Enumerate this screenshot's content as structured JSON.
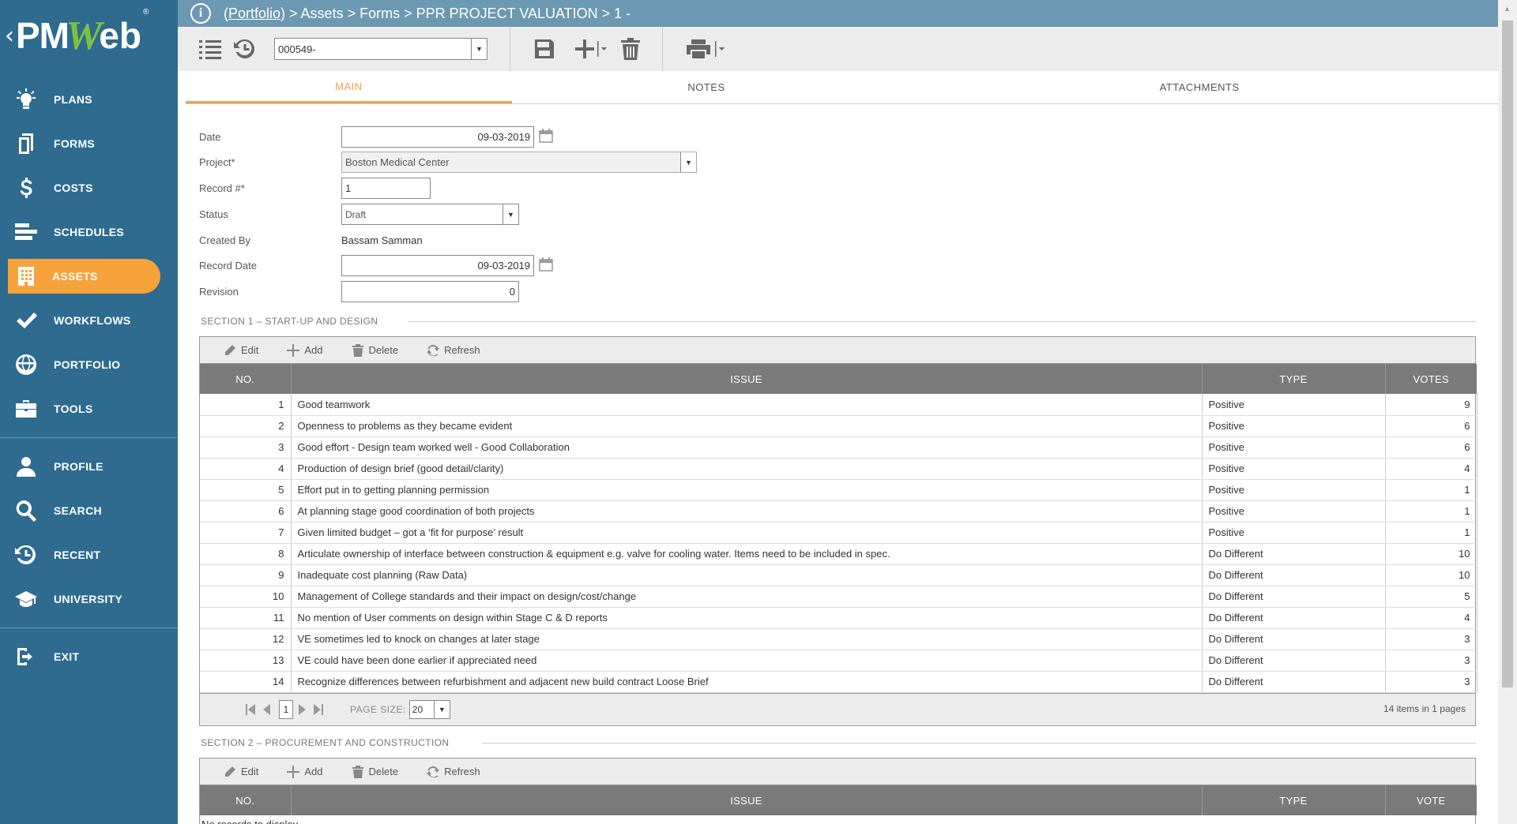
{
  "logo": {
    "back": "‹",
    "pm": "PM",
    "w": "W",
    "eb": "eb",
    "reg": "®"
  },
  "sidebar": {
    "group1": [
      {
        "label": "PLANS",
        "icon": "lightbulb-icon"
      },
      {
        "label": "FORMS",
        "icon": "document-icon"
      },
      {
        "label": "COSTS",
        "icon": "dollar-icon"
      },
      {
        "label": "SCHEDULES",
        "icon": "bars-icon"
      },
      {
        "label": "ASSETS",
        "icon": "building-icon",
        "active": true
      },
      {
        "label": "WORKFLOWS",
        "icon": "check-icon"
      },
      {
        "label": "PORTFOLIO",
        "icon": "globe-icon"
      },
      {
        "label": "TOOLS",
        "icon": "briefcase-icon"
      }
    ],
    "group2": [
      {
        "label": "PROFILE",
        "icon": "user-icon"
      },
      {
        "label": "SEARCH",
        "icon": "search-icon"
      },
      {
        "label": "RECENT",
        "icon": "history-icon"
      },
      {
        "label": "UNIVERSITY",
        "icon": "graduation-cap-icon"
      }
    ],
    "group3": [
      {
        "label": "EXIT",
        "icon": "exit-icon"
      }
    ]
  },
  "breadcrumb": {
    "info": "i",
    "portfolio": "(Portfolio)",
    "rest": " > Assets > Forms > PPR PROJECT VALUATION > 1 -"
  },
  "toolbar": {
    "record_value": "000549-"
  },
  "tabs": [
    "MAIN",
    "NOTES",
    "ATTACHMENTS"
  ],
  "form": {
    "date_label": "Date",
    "date_value": "09-03-2019",
    "project_label": "Project*",
    "project_value": "Boston Medical Center",
    "record_label": "Record #*",
    "record_value": "1",
    "status_label": "Status",
    "status_value": "Draft",
    "created_by_label": "Created By",
    "created_by_value": "Bassam Samman",
    "record_date_label": "Record Date",
    "record_date_value": "09-03-2019",
    "revision_label": "Revision",
    "revision_value": "0"
  },
  "section1": {
    "title": "SECTION 1 – START-UP AND DESIGN",
    "tools": {
      "edit": "Edit",
      "add": "Add",
      "delete": "Delete",
      "refresh": "Refresh"
    },
    "columns": [
      "NO.",
      "ISSUE",
      "TYPE",
      "VOTES"
    ],
    "rows": [
      {
        "no": "1",
        "issue": "Good teamwork",
        "type": "Positive",
        "votes": "9"
      },
      {
        "no": "2",
        "issue": "Openness to problems as they became evident",
        "type": "Positive",
        "votes": "6"
      },
      {
        "no": "3",
        "issue": "Good effort - Design team worked well - Good Collaboration",
        "type": "Positive",
        "votes": "6"
      },
      {
        "no": "4",
        "issue": "Production of design brief (good detail/clarity)",
        "type": "Positive",
        "votes": "4"
      },
      {
        "no": "5",
        "issue": "Effort put in to getting planning permission",
        "type": "Positive",
        "votes": "1"
      },
      {
        "no": "6",
        "issue": "At planning stage good coordination of both projects",
        "type": "Positive",
        "votes": "1"
      },
      {
        "no": "7",
        "issue": "Given limited budget – got a ‘fit for purpose’ result",
        "type": "Positive",
        "votes": "1"
      },
      {
        "no": "8",
        "issue": "Articulate ownership of interface between construction & equipment e.g. valve for cooling water. Items need to be included in spec.",
        "type": "Do Different",
        "votes": "10"
      },
      {
        "no": "9",
        "issue": "Inadequate cost planning (Raw Data)",
        "type": "Do Different",
        "votes": "10"
      },
      {
        "no": "10",
        "issue": "Management of College standards and their impact on design/cost/change",
        "type": "Do Different",
        "votes": "5"
      },
      {
        "no": "11",
        "issue": "No mention of User comments on design within Stage C & D reports",
        "type": "Do Different",
        "votes": "4"
      },
      {
        "no": "12",
        "issue": "VE sometimes led to knock on changes at later stage",
        "type": "Do Different",
        "votes": "3"
      },
      {
        "no": "13",
        "issue": "VE could have been done earlier if appreciated need",
        "type": "Do Different",
        "votes": "3"
      },
      {
        "no": "14",
        "issue": "Recognize differences between refurbishment and adjacent new build contract Loose Brief",
        "type": "Do Different",
        "votes": "3"
      }
    ],
    "pager": {
      "page": "1",
      "page_size_label": "PAGE SIZE:",
      "page_size": "20",
      "info": "14 items in 1 pages"
    }
  },
  "section2": {
    "title": "SECTION 2 – PROCUREMENT AND CONSTRUCTION",
    "tools": {
      "edit": "Edit",
      "add": "Add",
      "delete": "Delete",
      "refresh": "Refresh"
    },
    "columns": [
      "NO.",
      "ISSUE",
      "TYPE",
      "VOTE"
    ],
    "empty": "No records to display"
  }
}
